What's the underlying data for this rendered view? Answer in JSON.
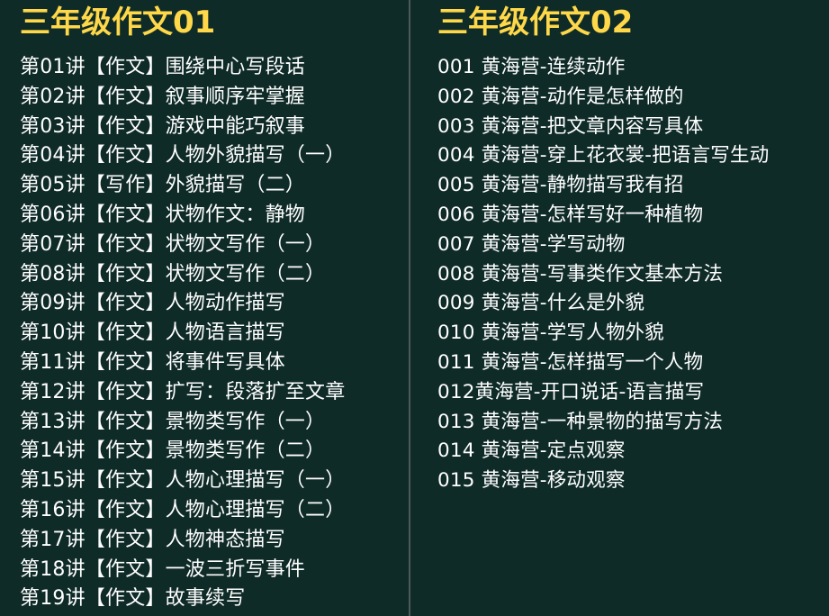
{
  "left": {
    "title": "三年级作文01",
    "items": [
      "第01讲【作文】围绕中心写段话",
      "第02讲【作文】叙事顺序牢掌握",
      "第03讲【作文】游戏中能巧叙事",
      "第04讲【作文】人物外貌描写（一）",
      "第05讲【写作】外貌描写（二）",
      "第06讲【作文】状物作文：静物",
      "第07讲【作文】状物文写作（一）",
      "第08讲【作文】状物文写作（二）",
      "第09讲【作文】人物动作描写",
      "第10讲【作文】人物语言描写",
      "第11讲【作文】将事件写具体",
      "第12讲【作文】扩写：段落扩至文章",
      "第13讲【作文】景物类写作（一）",
      "第14讲【作文】景物类写作（二）",
      "第15讲【作文】人物心理描写（一）",
      "第16讲【作文】人物心理描写（二）",
      "第17讲【作文】人物神态描写",
      "第18讲【作文】一波三折写事件",
      "第19讲【作文】故事续写"
    ]
  },
  "right": {
    "title": "三年级作文02",
    "items": [
      "001 黄海营-连续动作",
      "002 黄海营-动作是怎样做的",
      "003 黄海营-把文章内容写具体",
      "004 黄海营-穿上花衣裳-把语言写生动",
      "005 黄海营-静物描写我有招",
      "006 黄海营-怎样写好一种植物",
      "007 黄海营-学写动物",
      "008 黄海营-写事类作文基本方法",
      "009 黄海营-什么是外貌",
      "010 黄海营-学写人物外貌",
      "011 黄海营-怎样描写一个人物",
      "012黄海营-开口说话-语言描写",
      "013 黄海营-一种景物的描写方法",
      "014 黄海营-定点观察",
      "015 黄海营-移动观察"
    ]
  },
  "colors": {
    "background": "#0f2b28",
    "title": "#ffd84a",
    "text": "#ffffff",
    "divider": "#4a5a58"
  }
}
